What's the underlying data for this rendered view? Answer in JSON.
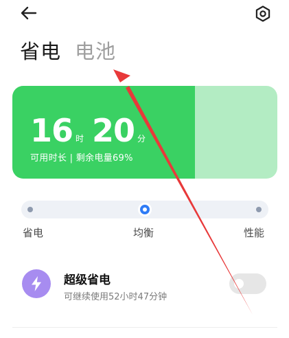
{
  "header": {
    "back_icon": "back-arrow-icon",
    "settings_icon": "gear-icon"
  },
  "tabs": [
    {
      "label": "省电",
      "active": true
    },
    {
      "label": "电池",
      "active": false
    }
  ],
  "battery": {
    "hours": "16",
    "hours_unit": "时",
    "minutes": "20",
    "minutes_unit": "分",
    "subtitle": "可用时长 | 剩余电量69%",
    "level": 0.69,
    "fill_color": "#3ad163",
    "empty_color": "#b3ecc3"
  },
  "mode_slider": {
    "options": [
      "省电",
      "均衡",
      "性能"
    ],
    "selected": "均衡",
    "accent": "#2f7cf6"
  },
  "super_saver": {
    "icon": "lightning-icon",
    "title": "超级省电",
    "subtitle": "可继续使用52小时47分钟",
    "enabled": false,
    "icon_color": "#a78cf0"
  },
  "annotation_arrow": {
    "color": "#e8393a"
  }
}
